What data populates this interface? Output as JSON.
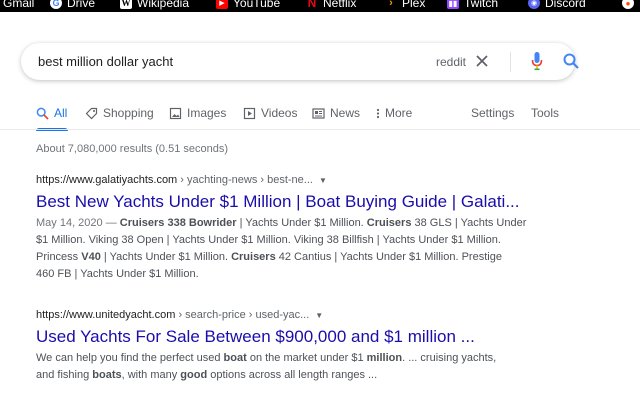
{
  "bookmarks": [
    {
      "label": "Gmail",
      "icon": "gmail-icon",
      "color": "#ea4335"
    },
    {
      "label": "Drive",
      "icon": "google-icon",
      "color": "#4285f4"
    },
    {
      "label": "Wikipedia",
      "icon": "wikipedia-icon",
      "color": "#ffffff"
    },
    {
      "label": "YouTube",
      "icon": "youtube-icon",
      "color": "#ff0000"
    },
    {
      "label": "Netflix",
      "icon": "netflix-icon",
      "color": "#e50914"
    },
    {
      "label": "Plex",
      "icon": "plex-icon",
      "color": "#e5a00d"
    },
    {
      "label": "Twitch",
      "icon": "twitch-icon",
      "color": "#9146ff"
    },
    {
      "label": "Discord",
      "icon": "discord-icon",
      "color": "#5865f2"
    }
  ],
  "search": {
    "query": "best million dollar yacht",
    "suggestion_chip": "reddit"
  },
  "tabs": [
    {
      "label": "All",
      "icon": "search-icon",
      "active": true
    },
    {
      "label": "Shopping",
      "icon": "tag-icon",
      "active": false
    },
    {
      "label": "Images",
      "icon": "image-icon",
      "active": false
    },
    {
      "label": "Videos",
      "icon": "play-icon",
      "active": false
    },
    {
      "label": "News",
      "icon": "newspaper-icon",
      "active": false
    },
    {
      "label": "More",
      "icon": "more-vert-icon",
      "active": false
    },
    {
      "label": "Settings",
      "icon": "",
      "active": false
    },
    {
      "label": "Tools",
      "icon": "",
      "active": false
    }
  ],
  "stats": "About 7,080,000 results (0.51 seconds)",
  "results": [
    {
      "url_base": "https://www.galatiyachts.com",
      "url_path": " › yachting-news › best-ne...",
      "title": "Best New Yachts Under $1 Million | Boat Buying Guide | Galati...",
      "date": "May 14, 2020",
      "snippet_lines": [
        [
          [
            "",
            ""
          ],
          [
            "b",
            "Cruisers 338 Bowrider"
          ],
          [
            "",
            " | Yachts Under $1 Million. "
          ],
          [
            "b",
            "Cruisers"
          ],
          [
            "",
            " 38 GLS | Yachts Under"
          ]
        ],
        [
          [
            "",
            "$1 Million. Viking 38 Open | Yachts Under $1 Million. Viking 38 Billfish | Yachts Under $1 Million."
          ]
        ],
        [
          [
            "",
            "Princess "
          ],
          [
            "b",
            "V40"
          ],
          [
            "",
            " | Yachts Under $1 Million. "
          ],
          [
            "b",
            "Cruisers"
          ],
          [
            "",
            " 42 Cantius | Yachts Under $1 Million. Prestige"
          ]
        ],
        [
          [
            "",
            "460 FB | Yachts Under $1 Million."
          ]
        ]
      ]
    },
    {
      "url_base": "https://www.unitedyacht.com",
      "url_path": " › search-price › used-yac...",
      "title": "Used Yachts For Sale Between $900,000 and $1 million ...",
      "date": "",
      "snippet_lines": [
        [
          [
            "",
            "We can help you find the perfect used "
          ],
          [
            "b",
            "boat"
          ],
          [
            "",
            " on the market under $1 "
          ],
          [
            "b",
            "million"
          ],
          [
            "",
            ". ... cruising yachts,"
          ]
        ],
        [
          [
            "",
            "and fishing "
          ],
          [
            "b",
            "boats"
          ],
          [
            "",
            ", with many "
          ],
          [
            "b",
            "good"
          ],
          [
            "",
            " options across all length ranges ..."
          ]
        ]
      ]
    }
  ],
  "colors": {
    "link": "#1a0dab",
    "accent": "#1a73e8",
    "muted": "#70757a"
  }
}
